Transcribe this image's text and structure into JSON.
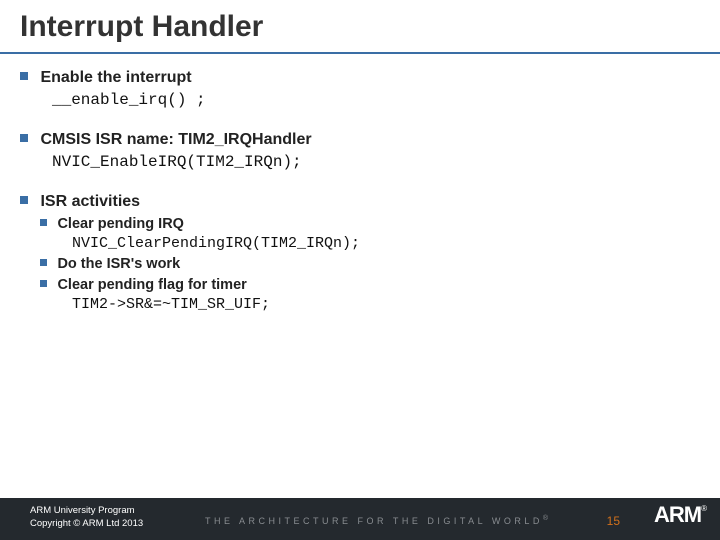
{
  "title": "Interrupt Handler",
  "b1": {
    "heading": "Enable the interrupt",
    "code": "__enable_irq() ;"
  },
  "b2": {
    "heading": "CMSIS ISR name: TIM2_IRQHandler",
    "code": "NVIC_EnableIRQ(TIM2_IRQn);"
  },
  "b3": {
    "heading": "ISR activities",
    "s1": {
      "label": "Clear pending IRQ",
      "code": "NVIC_ClearPendingIRQ(TIM2_IRQn);"
    },
    "s2": {
      "label": "Do the ISR's work"
    },
    "s3": {
      "label": "Clear pending flag for timer",
      "code": "TIM2->SR&=~TIM_SR_UIF;"
    }
  },
  "footer": {
    "line1": "ARM University Program",
    "line2": "Copyright © ARM Ltd 2013",
    "tagline": "THE ARCHITECTURE FOR THE DIGITAL WORLD",
    "page": "15",
    "logo": "ARM"
  }
}
